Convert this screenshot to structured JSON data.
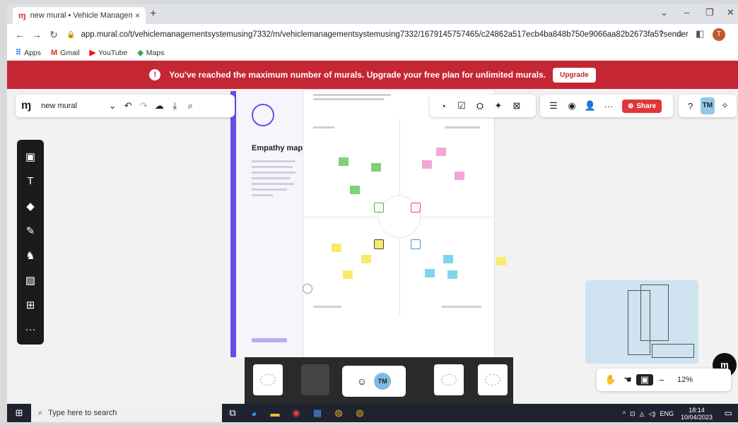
{
  "browser": {
    "tab_title": "new mural • Vehicle Managemen",
    "tab_close": "×",
    "new_tab": "+",
    "url": "app.mural.co/t/vehiclemanagementsystemusing7332/m/vehiclemanagementsystemusing7332/1679145757465/c24862a517ecb4ba848b750e9066aa82b2673fa5?sender...",
    "avatar_letter": "T",
    "bookmarks": [
      {
        "label": "Apps"
      },
      {
        "label": "Gmail"
      },
      {
        "label": "YouTube"
      },
      {
        "label": "Maps"
      }
    ]
  },
  "banner": {
    "message": "You've reached the maximum number of murals. Upgrade your free plan for unlimited murals.",
    "button": "Upgrade"
  },
  "mural": {
    "name": "new mural",
    "share": "Share",
    "user_initials": "TM",
    "zoom": "12%"
  },
  "empathy": {
    "title": "Empathy map"
  },
  "voting": {
    "initials": "TM"
  },
  "taskbar": {
    "search_placeholder": "Type here to search",
    "lang": "ENG",
    "time": "18:14",
    "date": "10/04/2023"
  },
  "colors": {
    "banner": "#c52634",
    "share": "#e0353a",
    "accent": "#6b4ce6"
  }
}
